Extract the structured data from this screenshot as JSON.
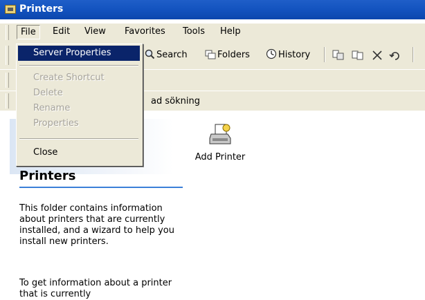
{
  "window": {
    "title": "Printers"
  },
  "menubar": {
    "items": [
      "File",
      "Edit",
      "View",
      "Favorites",
      "Tools",
      "Help"
    ]
  },
  "toolbar": {
    "search_label": "Search",
    "folders_label": "Folders",
    "history_label": "History"
  },
  "links_bar": {
    "text": "ad sökning"
  },
  "file_menu": {
    "items": [
      "Server Properties",
      "Create Shortcut",
      "Delete",
      "Rename",
      "Properties",
      "Close"
    ],
    "highlighted": "Server Properties",
    "disabled": [
      "Create Shortcut",
      "Delete",
      "Rename",
      "Properties"
    ]
  },
  "left_pane": {
    "title": "Printers",
    "description": "This folder contains information about printers that are currently installed, and a wizard to help you install new printers.",
    "description2": "To get information about a printer that is currently"
  },
  "items": [
    {
      "label": "Add Printer",
      "icon": "add-printer-icon"
    }
  ],
  "colors": {
    "titlebar": "#0b46ad",
    "menu_highlight": "#0a246a",
    "chrome": "#ece9d8",
    "pane_rule": "#3a7fd8"
  }
}
